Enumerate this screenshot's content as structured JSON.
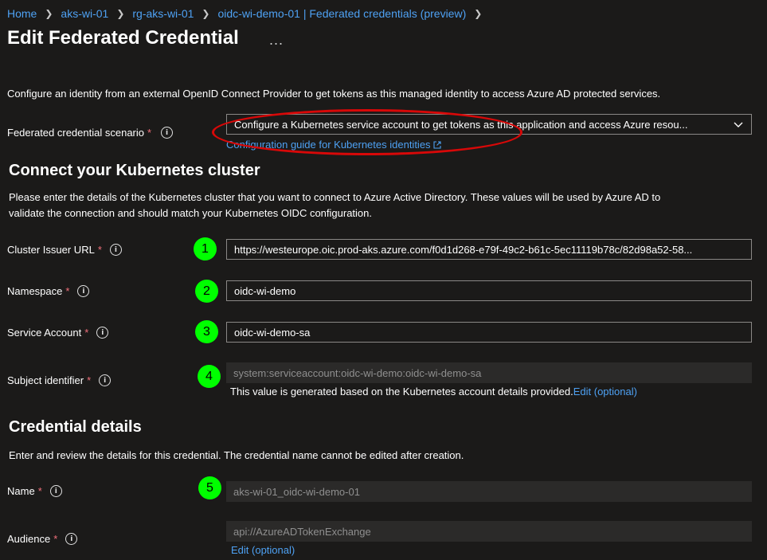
{
  "breadcrumb": [
    {
      "label": "Home"
    },
    {
      "label": "aks-wi-01"
    },
    {
      "label": "rg-aks-wi-01"
    },
    {
      "label": "oidc-wi-demo-01 | Federated credentials (preview)"
    }
  ],
  "page": {
    "title": "Edit Federated Credential",
    "more_actions": "...",
    "description": "Configure an identity from an external OpenID Connect Provider to get tokens as this managed identity to access Azure AD protected services."
  },
  "scenario": {
    "label": "Federated credential scenario",
    "required_mark": "*",
    "value": "Configure a Kubernetes service account to get tokens as this application and access Azure resou...",
    "guide_link": "Configuration guide for Kubernetes identities"
  },
  "cluster": {
    "heading": "Connect your Kubernetes cluster",
    "description_line1": "Please enter the details of the Kubernetes cluster that you want to connect to Azure Active Directory. These values will be used by Azure AD to",
    "description_line2": "validate the connection and should match your Kubernetes OIDC configuration.",
    "issuer": {
      "label": "Cluster Issuer URL",
      "badge": "1",
      "value": "https://westeurope.oic.prod-aks.azure.com/f0d1d268-e79f-49c2-b61c-5ec11119b78c/82d98a52-58..."
    },
    "namespace": {
      "label": "Namespace",
      "badge": "2",
      "value": "oidc-wi-demo"
    },
    "service_account": {
      "label": "Service Account",
      "badge": "3",
      "value": "oidc-wi-demo-sa"
    },
    "subject": {
      "label": "Subject identifier",
      "badge": "4",
      "value": "system:serviceaccount:oidc-wi-demo:oidc-wi-demo-sa",
      "note": "This value is generated based on the Kubernetes account details provided.",
      "edit_link": "Edit (optional)"
    }
  },
  "credential": {
    "heading": "Credential details",
    "description": "Enter and review the details for this credential. The credential name cannot be edited after creation.",
    "name": {
      "label": "Name",
      "badge": "5",
      "value": "aks-wi-01_oidc-wi-demo-01"
    },
    "audience": {
      "label": "Audience",
      "value": "api://AzureADTokenExchange",
      "edit_link": "Edit (optional)"
    }
  },
  "icons": {
    "info": "info-icon",
    "chevron": "chevron-down-icon",
    "external": "external-link-icon",
    "breadcrumb_sep": "chevron-right-icon"
  },
  "colors": {
    "background": "#1b1a19",
    "link": "#4ea1f3",
    "required": "#f1707b",
    "badge": "#00ff00",
    "highlight": "#d80808"
  }
}
